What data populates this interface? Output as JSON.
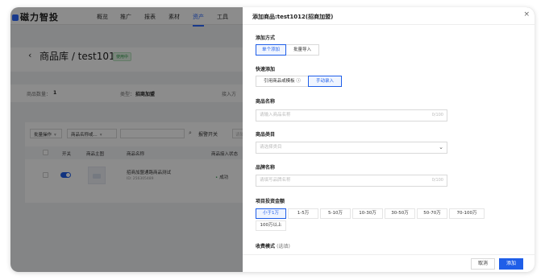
{
  "app": {
    "logo": "磁力智投",
    "nav": [
      "概览",
      "推广",
      "报表",
      "素材",
      "资产",
      "工具"
    ],
    "active_nav": "资产"
  },
  "page": {
    "title": "商品库 / test1012",
    "status": "使用中",
    "stats": {
      "count_label": "商品数量：",
      "count_value": "1",
      "type_label": "类型：",
      "type_value": "招商加盟",
      "import_label": "接入方"
    },
    "filters": {
      "batch_ops": "批量操作",
      "name_id": "商品名称或...",
      "filter_btn": "报警开关",
      "search_placeholder": "请输"
    },
    "table": {
      "columns": [
        "开关",
        "商品主图",
        "商品名称",
        "商品接入状态"
      ],
      "rows": [
        {
          "name": "招商加盟通路商品测试",
          "id": "ID: 256305489",
          "state": "成功"
        }
      ]
    }
  },
  "drawer": {
    "title": "添加商品:test1012(招商加盟)",
    "add_method": {
      "label": "添加方式",
      "options": [
        "单个添加",
        "批量导入"
      ],
      "selected": "单个添加"
    },
    "quick_add": {
      "label": "快速添加",
      "options": [
        "引用商品或模板 ⓘ",
        "手动录入"
      ],
      "selected": "手动录入"
    },
    "product_name": {
      "label": "商品名称",
      "placeholder": "请输入商品名称",
      "counter": "0/100"
    },
    "category": {
      "label": "商品类目",
      "placeholder": "请选择类目"
    },
    "brand": {
      "label": "品牌名称",
      "placeholder": "请填写品牌名称",
      "counter": "0/100"
    },
    "investment": {
      "label": "项目投资金额",
      "options": [
        "小于1万",
        "1-5万",
        "5-10万",
        "10-30万",
        "30-50万",
        "50-70万",
        "70-100万",
        "100万以上"
      ],
      "selected": "小于1万"
    },
    "fee_model": {
      "label": "收费模式",
      "optional": "(选填)"
    },
    "footer": {
      "cancel": "取消",
      "submit": "添加"
    }
  }
}
